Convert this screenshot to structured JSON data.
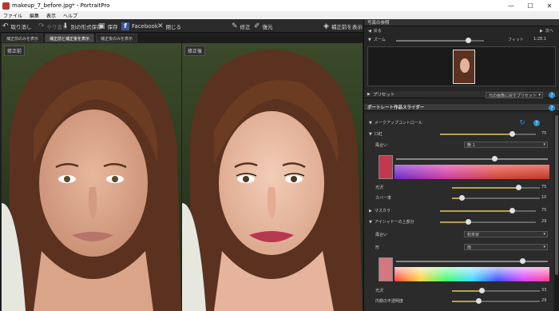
{
  "window": {
    "title": "makeup_7_before.jpg* - PortraitPro",
    "minimize": "—",
    "maximize": "☐",
    "close": "✕"
  },
  "menu": [
    "ファイル",
    "編集",
    "表示",
    "ヘルプ"
  ],
  "toolbar": {
    "undo": "取り消し",
    "redo": "やり直し",
    "save_as": "別の形式保存",
    "save": "保存",
    "facebook": "Facebook",
    "close": "閉じる",
    "fix": "修正",
    "restore": "復元",
    "show_before": "補正前を表示"
  },
  "view_tabs": [
    "補正前のみを表示",
    "補正前と補正後を表示",
    "補正後のみを表示"
  ],
  "photos": {
    "before_label": "修正前",
    "after_label": "修正後"
  },
  "panel": {
    "photo_section": "写真の参照",
    "back": "戻る",
    "next": "次へ",
    "zoom_label": "ズーム",
    "zoom_value": 0.42,
    "fit_label": "フィット",
    "fit_value": "1:28.1",
    "preset_label": "プリセット",
    "preset_option": "元の画像に戻すプリセット",
    "sliders_section": "ポートレート作品スライダー",
    "makeup_control": "メークアップコントロール",
    "lipstick": "口紅",
    "lipstick_value": "75",
    "lipstick_level": 0.75,
    "type_label": "風合い",
    "type_value": "艶 1",
    "gloss_label": "光沢",
    "gloss_value": "75",
    "gloss_level": 0.75,
    "coverage_label": "カバー率",
    "coverage_value": "10",
    "coverage_level": 0.1,
    "mascara": "マスカラ",
    "mascara_value": "75",
    "mascara_level": 0.75,
    "eyeliner": "アイシャドーの上部分",
    "eyeliner_value": "29",
    "eyeliner_level": 0.29,
    "style_label": "風合い",
    "style_value": "粉末状",
    "shape_label": "形",
    "shape_value": "扇",
    "shine_label": "光沢",
    "shine_value": "33",
    "shine_level": 0.33,
    "inner_label": "内側の不透明度",
    "inner_value": "29",
    "inner_level": 0.29
  },
  "colors": {
    "lip_swatch": "#c0394e",
    "eye_swatch": "#d2787e",
    "accent": "#b8a24a",
    "help": "#2a8fc9"
  }
}
